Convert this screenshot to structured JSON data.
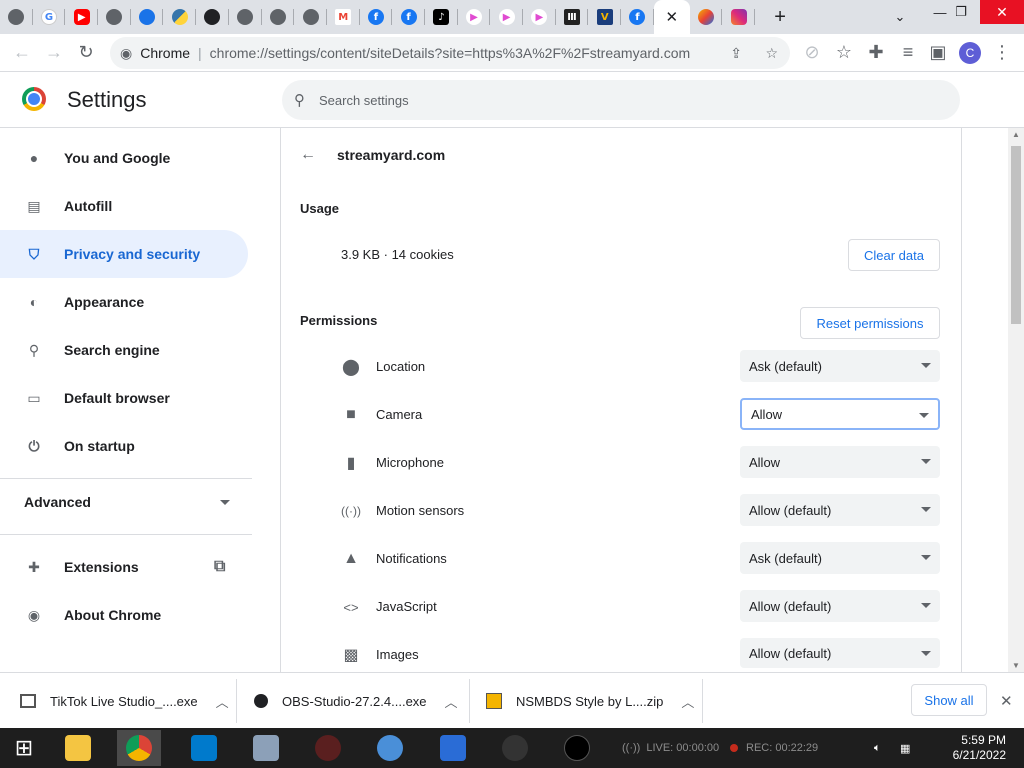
{
  "browser": {
    "address_site": "Chrome",
    "address_url": "chrome://settings/content/siteDetails?site=https%3A%2F%2Fstreamyard.com",
    "profile_initial": "C"
  },
  "settings": {
    "title": "Settings",
    "search_placeholder": "Search settings"
  },
  "sidebar": {
    "items": [
      {
        "label": "You and Google"
      },
      {
        "label": "Autofill"
      },
      {
        "label": "Privacy and security"
      },
      {
        "label": "Appearance"
      },
      {
        "label": "Search engine"
      },
      {
        "label": "Default browser"
      },
      {
        "label": "On startup"
      }
    ],
    "advanced_label": "Advanced",
    "extensions_label": "Extensions",
    "about_label": "About Chrome"
  },
  "site": {
    "name": "streamyard.com",
    "usage_heading": "Usage",
    "usage_text": "3.9 KB · 14 cookies",
    "clear_data_label": "Clear data",
    "permissions_heading": "Permissions",
    "reset_permissions_label": "Reset permissions",
    "permissions": [
      {
        "label": "Location",
        "value": "Ask (default)",
        "icon": "location-pin-icon"
      },
      {
        "label": "Camera",
        "value": "Allow",
        "icon": "camera-icon"
      },
      {
        "label": "Microphone",
        "value": "Allow",
        "icon": "microphone-icon"
      },
      {
        "label": "Motion sensors",
        "value": "Allow (default)",
        "icon": "motion-sensors-icon"
      },
      {
        "label": "Notifications",
        "value": "Ask (default)",
        "icon": "bell-icon"
      },
      {
        "label": "JavaScript",
        "value": "Allow (default)",
        "icon": "code-icon"
      },
      {
        "label": "Images",
        "value": "Allow (default)",
        "icon": "image-icon"
      }
    ]
  },
  "downloads": {
    "items": [
      {
        "name": "TikTok Live Studio_....exe"
      },
      {
        "name": "OBS-Studio-27.2.4....exe"
      },
      {
        "name": "NSMBDS Style by L....zip"
      }
    ],
    "show_all_label": "Show all"
  },
  "taskbar": {
    "live_text": "LIVE: 00:00:00",
    "rec_text": "REC: 00:22:29",
    "time": "5:59 PM",
    "date": "6/21/2022"
  }
}
